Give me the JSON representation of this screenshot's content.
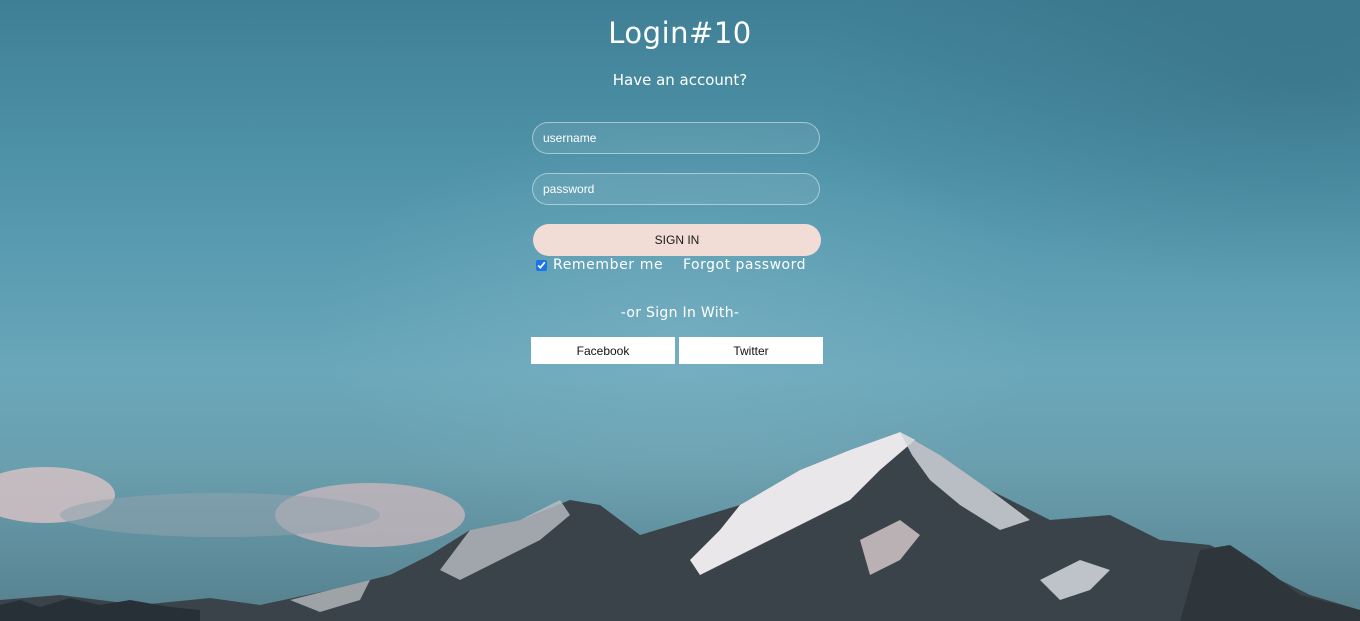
{
  "header": {
    "title": "Login#10",
    "subtitle": "Have an account?"
  },
  "form": {
    "username_placeholder": "username",
    "password_placeholder": "password",
    "signin_label": "SIGN IN",
    "remember_label": "Remember me",
    "remember_checked": true,
    "forgot_label": "Forgot password"
  },
  "social": {
    "divider_text": "-or Sign In With-",
    "facebook_label": "Facebook",
    "twitter_label": "Twitter"
  },
  "colors": {
    "signin_bg": "#f2ddd6",
    "social_bg": "#ffffff",
    "text": "#ffffff"
  }
}
